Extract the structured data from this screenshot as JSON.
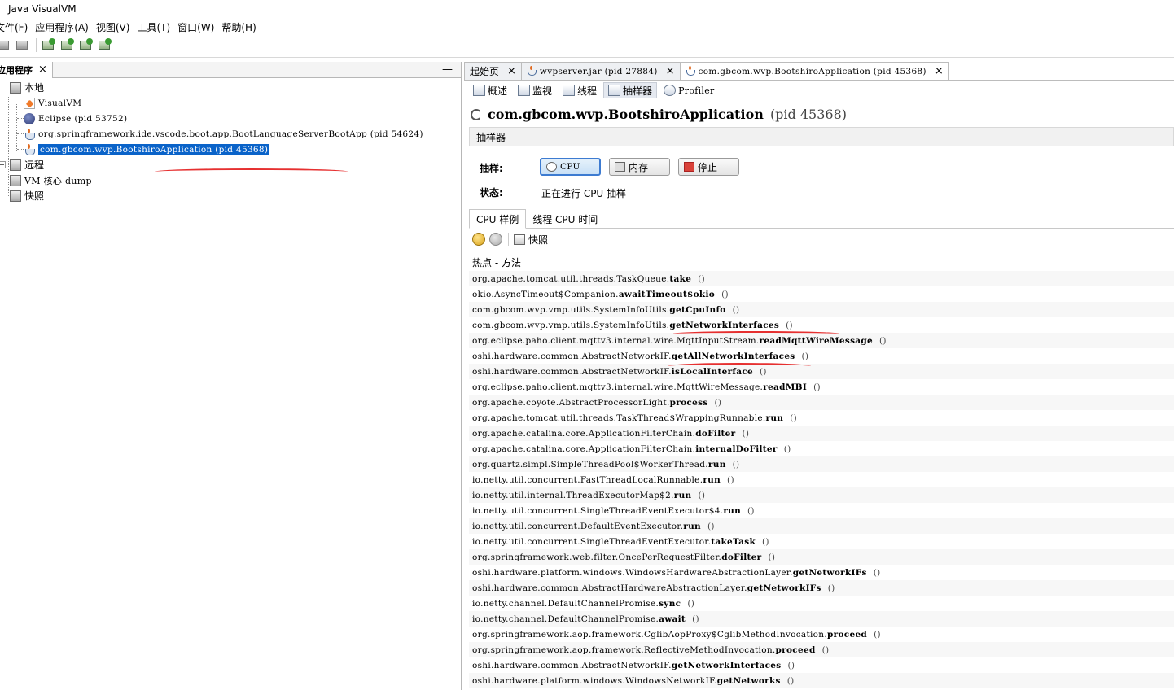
{
  "window": {
    "title": "Java VisualVM"
  },
  "menu": [
    "文件(F)",
    "应用程序(A)",
    "视图(V)",
    "工具(T)",
    "窗口(W)",
    "帮助(H)"
  ],
  "left_panel": {
    "tab_label": "应用程序",
    "tab_close": "×",
    "minimize": "—",
    "tree": {
      "local": "本地",
      "local_items": [
        {
          "label": "VisualVM",
          "icon": "visualvm-icon"
        },
        {
          "label": "Eclipse (pid 53752)",
          "icon": "eclipse-icon"
        },
        {
          "label": "org.springframework.ide.vscode.boot.app.BootLanguageServerBootApp (pid 54624)",
          "icon": "java-icon"
        },
        {
          "label": "com.gbcom.wvp.BootshiroApplication (pid 45368)",
          "icon": "java-icon",
          "selected": true
        }
      ],
      "remote": "远程",
      "vm_core_dump": "VM 核心 dump",
      "snapshots": "快照"
    }
  },
  "doc_tabs": [
    {
      "label": "起始页",
      "close": "×"
    },
    {
      "label": "wvpserver.jar (pid 27884)",
      "close": "×"
    },
    {
      "label": "com.gbcom.wvp.BootshiroApplication (pid 45368)",
      "close": "×",
      "active": true
    }
  ],
  "sub_tabs": [
    "概述",
    "监视",
    "线程",
    "抽样器",
    "Profiler"
  ],
  "app": {
    "name": "com.gbcom.wvp.BootshiroApplication",
    "pid": "(pid 45368)"
  },
  "sampler": {
    "header": "抽样器",
    "sample_label": "抽样:",
    "status_label": "状态:",
    "status_value": "正在进行 CPU 抽样",
    "buttons": {
      "cpu": "CPU",
      "memory": "内存",
      "stop": "停止"
    },
    "tabs": [
      "CPU 样例",
      "线程 CPU 时间"
    ],
    "snapshot_label": "快照",
    "hotspots_title": "热点 - 方法"
  },
  "methods": [
    {
      "cls": "org.apache.tomcat.util.threads.TaskQueue.",
      "method": "take"
    },
    {
      "cls": "okio.AsyncTimeout$Companion.",
      "method": "awaitTimeout$okio"
    },
    {
      "cls": "com.gbcom.wvp.vmp.utils.SystemInfoUtils.",
      "method": "getCpuInfo"
    },
    {
      "cls": "com.gbcom.wvp.vmp.utils.SystemInfoUtils.",
      "method": "getNetworkInterfaces"
    },
    {
      "cls": "org.eclipse.paho.client.mqttv3.internal.wire.MqttInputStream.",
      "method": "readMqttWireMessage"
    },
    {
      "cls": "oshi.hardware.common.AbstractNetworkIF.",
      "method": "getAllNetworkInterfaces"
    },
    {
      "cls": "oshi.hardware.common.AbstractNetworkIF.",
      "method": "isLocalInterface"
    },
    {
      "cls": "org.eclipse.paho.client.mqttv3.internal.wire.MqttWireMessage.",
      "method": "readMBI"
    },
    {
      "cls": "org.apache.coyote.AbstractProcessorLight.",
      "method": "process"
    },
    {
      "cls": "org.apache.tomcat.util.threads.TaskThread$WrappingRunnable.",
      "method": "run"
    },
    {
      "cls": "org.apache.catalina.core.ApplicationFilterChain.",
      "method": "doFilter"
    },
    {
      "cls": "org.apache.catalina.core.ApplicationFilterChain.",
      "method": "internalDoFilter"
    },
    {
      "cls": "org.quartz.simpl.SimpleThreadPool$WorkerThread.",
      "method": "run"
    },
    {
      "cls": "io.netty.util.concurrent.FastThreadLocalRunnable.",
      "method": "run"
    },
    {
      "cls": "io.netty.util.internal.ThreadExecutorMap$2.",
      "method": "run"
    },
    {
      "cls": "io.netty.util.concurrent.SingleThreadEventExecutor$4.",
      "method": "run"
    },
    {
      "cls": "io.netty.util.concurrent.DefaultEventExecutor.",
      "method": "run"
    },
    {
      "cls": "io.netty.util.concurrent.SingleThreadEventExecutor.",
      "method": "takeTask"
    },
    {
      "cls": "org.springframework.web.filter.OncePerRequestFilter.",
      "method": "doFilter"
    },
    {
      "cls": "oshi.hardware.platform.windows.WindowsHardwareAbstractionLayer.",
      "method": "getNetworkIFs"
    },
    {
      "cls": "oshi.hardware.common.AbstractHardwareAbstractionLayer.",
      "method": "getNetworkIFs"
    },
    {
      "cls": "io.netty.channel.DefaultChannelPromise.",
      "method": "sync"
    },
    {
      "cls": "io.netty.channel.DefaultChannelPromise.",
      "method": "await"
    },
    {
      "cls": "org.springframework.aop.framework.CglibAopProxy$CglibMethodInvocation.",
      "method": "proceed"
    },
    {
      "cls": "org.springframework.aop.framework.ReflectiveMethodInvocation.",
      "method": "proceed"
    },
    {
      "cls": "oshi.hardware.common.AbstractNetworkIF.",
      "method": "getNetworkInterfaces"
    },
    {
      "cls": "oshi.hardware.platform.windows.WindowsNetworkIF.",
      "method": "getNetworks"
    }
  ],
  "paren": "()",
  "colors": {
    "selection": "#0a63c9",
    "annotation": "#e63030",
    "active_button": "#3d7bd1"
  }
}
